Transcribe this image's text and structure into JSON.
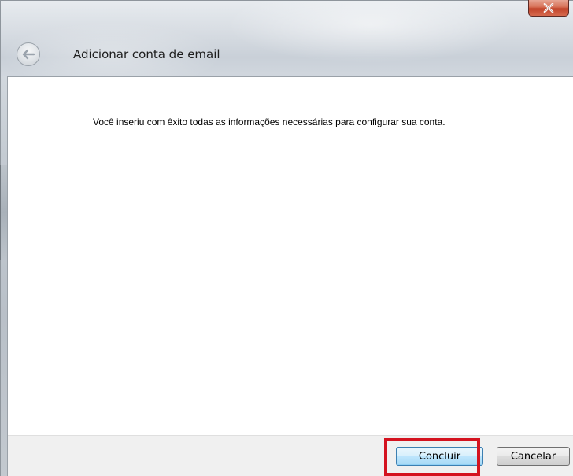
{
  "window": {
    "title": "Adicionar conta de email"
  },
  "icons": {
    "back": "back-arrow-icon",
    "close": "close-icon"
  },
  "content": {
    "message": "Você inseriu com êxito todas as informações necessárias para configurar sua conta."
  },
  "footer": {
    "finish_label": "Concluir",
    "cancel_label": "Cancelar"
  },
  "colors": {
    "highlight": "#d4121f",
    "close_button": "#c1442a",
    "primary_button_border": "#3c7fb1"
  }
}
